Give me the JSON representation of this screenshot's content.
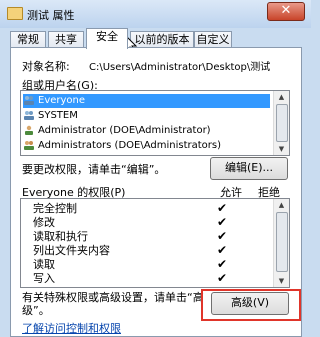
{
  "window": {
    "title": "测试 属性",
    "close_glyph": "✕"
  },
  "tabs": [
    {
      "label": "常规"
    },
    {
      "label": "共享"
    },
    {
      "label": "安全"
    },
    {
      "label": "以前的版本"
    },
    {
      "label": "自定义"
    }
  ],
  "security": {
    "object_label": "对象名称:",
    "object_value": "C:\\Users\\Administrator\\Desktop\\测试",
    "group_label": "组或用户名(G):",
    "users": [
      {
        "name": "Everyone",
        "icon": "user-group-icon"
      },
      {
        "name": "SYSTEM",
        "icon": "user-group-icon"
      },
      {
        "name": "Administrator (DOE\\Administrator)",
        "icon": "user-icon"
      },
      {
        "name": "Administrators (DOE\\Administrators)",
        "icon": "user-group-icon"
      }
    ],
    "edit_hint": "要更改权限，请单击“编辑”。",
    "edit_button": "编辑(E)...",
    "perm_header": "Everyone 的权限(P)",
    "allow_header": "允许",
    "deny_header": "拒绝",
    "permissions": [
      {
        "name": "完全控制",
        "allow": "✔"
      },
      {
        "name": "修改",
        "allow": "✔"
      },
      {
        "name": "读取和执行",
        "allow": "✔"
      },
      {
        "name": "列出文件夹内容",
        "allow": "✔"
      },
      {
        "name": "读取",
        "allow": "✔"
      },
      {
        "name": "写入",
        "allow": "✔"
      }
    ],
    "advanced_hint_line1": "有关特殊权限或高级设置，请单击“高",
    "advanced_hint_line2": "级”。",
    "advanced_button": "高级(V)",
    "learn_link": "了解访问控制和权限"
  },
  "colors": {
    "selection": "#3399ff",
    "highlight_box": "#e0352a",
    "link": "#0645ad"
  }
}
